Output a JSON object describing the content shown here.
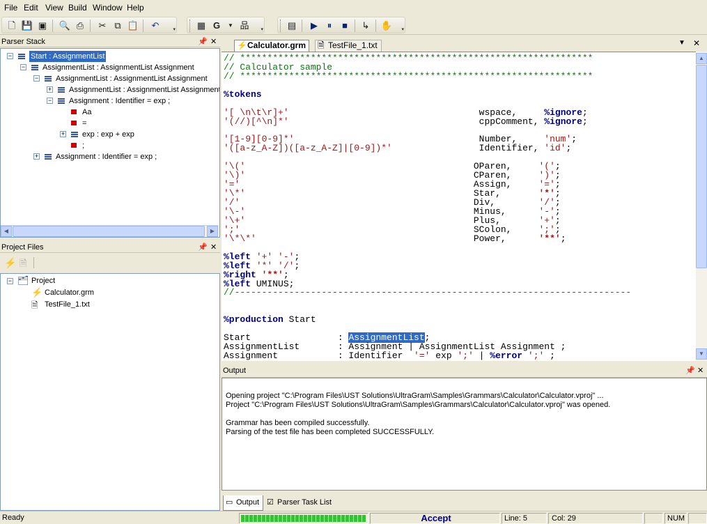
{
  "menu": [
    "File",
    "Edit",
    "View",
    "Build",
    "Window",
    "Help"
  ],
  "toolbar": {
    "icons": [
      "new-file-icon",
      "save-icon",
      "save-all-icon",
      "print-preview-icon",
      "print-icon",
      "cut-icon",
      "copy-icon",
      "paste-icon",
      "undo-icon",
      "grid-icon",
      "g-dropdown-icon",
      "tree-icon",
      "properties-icon",
      "run-icon",
      "pause-icon",
      "stop-icon",
      "step-icon",
      "hand-icon"
    ],
    "g_label": "G"
  },
  "parser_stack": {
    "title": "Parser Stack",
    "items": [
      {
        "label": "Start : AssignmentList",
        "level": 0,
        "icon": "list",
        "expander": "-",
        "selected": true
      },
      {
        "label": "AssignmentList : AssignmentList Assignment",
        "level": 1,
        "icon": "list",
        "expander": "-"
      },
      {
        "label": "AssignmentList : AssignmentList Assignment",
        "level": 2,
        "icon": "list",
        "expander": "-"
      },
      {
        "label": "AssignmentList : AssignmentList Assignment",
        "level": 3,
        "icon": "list",
        "expander": "+"
      },
      {
        "label": "Assignment : Identifier = exp ;",
        "level": 3,
        "icon": "list",
        "expander": "-"
      },
      {
        "label": "Aa",
        "level": 4,
        "icon": "term",
        "expander": ""
      },
      {
        "label": "=",
        "level": 4,
        "icon": "term",
        "expander": ""
      },
      {
        "label": "exp : exp + exp",
        "level": 4,
        "icon": "list",
        "expander": "+"
      },
      {
        "label": ";",
        "level": 4,
        "icon": "term",
        "expander": ""
      },
      {
        "label": "Assignment : Identifier = exp ;",
        "level": 2,
        "icon": "list",
        "expander": "+"
      }
    ]
  },
  "project_files": {
    "title": "Project Files",
    "root": "Project",
    "files": [
      "Calculator.grm",
      "TestFile_1.txt"
    ]
  },
  "editor": {
    "tabs": [
      {
        "label": "Calculator.grm",
        "active": true
      },
      {
        "label": "TestFile_1.txt",
        "active": false
      }
    ],
    "lines": [
      [
        [
          "g",
          "// *****************************************************************"
        ]
      ],
      [
        [
          "g",
          "// Calculator sample"
        ]
      ],
      [
        [
          "g",
          "// *****************************************************************"
        ]
      ],
      [],
      [
        [
          "kw",
          "%tokens"
        ]
      ],
      [],
      [
        [
          "s",
          "'[ \\n\\t\\r]+'"
        ],
        [
          "n",
          "                                   wspace,     "
        ],
        [
          "kw",
          "%ignore"
        ],
        [
          "n",
          ";"
        ]
      ],
      [
        [
          "s",
          "'(//)[^\\n]*'"
        ],
        [
          "n",
          "                                   cppComment, "
        ],
        [
          "kw",
          "%ignore"
        ],
        [
          "n",
          ";"
        ]
      ],
      [],
      [
        [
          "s",
          "'[1-9][0-9]*'"
        ],
        [
          "n",
          "                                  Number,     "
        ],
        [
          "s",
          "'num'"
        ],
        [
          "n",
          ";"
        ]
      ],
      [
        [
          "s",
          "'([a-z_A-Z])([a-z_A-Z]|[0-9])*'"
        ],
        [
          "n",
          "                Identifier, "
        ],
        [
          "s",
          "'id'"
        ],
        [
          "n",
          ";"
        ]
      ],
      [],
      [
        [
          "s",
          "'\\('"
        ],
        [
          "n",
          "                                          OParen,     "
        ],
        [
          "s",
          "'('"
        ],
        [
          "n",
          ";"
        ]
      ],
      [
        [
          "s",
          "'\\)'"
        ],
        [
          "n",
          "                                          CParen,     "
        ],
        [
          "s",
          "')'"
        ],
        [
          "n",
          ";"
        ]
      ],
      [
        [
          "s",
          "'='"
        ],
        [
          "n",
          "                                           Assign,     "
        ],
        [
          "s",
          "'='"
        ],
        [
          "n",
          ";"
        ]
      ],
      [
        [
          "s",
          "'\\*'"
        ],
        [
          "n",
          "                                          Star,       "
        ],
        [
          "sb",
          "'*'"
        ],
        [
          "n",
          ";"
        ]
      ],
      [
        [
          "s",
          "'/'"
        ],
        [
          "n",
          "                                           Div,        "
        ],
        [
          "s",
          "'/'"
        ],
        [
          "n",
          ";"
        ]
      ],
      [
        [
          "s",
          "'\\-'"
        ],
        [
          "n",
          "                                          Minus,      "
        ],
        [
          "s",
          "'-'"
        ],
        [
          "n",
          ";"
        ]
      ],
      [
        [
          "s",
          "'\\+'"
        ],
        [
          "n",
          "                                          Plus,       "
        ],
        [
          "s",
          "'+'"
        ],
        [
          "n",
          ";"
        ]
      ],
      [
        [
          "s",
          "';'"
        ],
        [
          "n",
          "                                           SColon,     "
        ],
        [
          "s",
          "';'"
        ],
        [
          "n",
          ";"
        ]
      ],
      [
        [
          "s",
          "'\\*\\*'"
        ],
        [
          "n",
          "                                        Power,      "
        ],
        [
          "sb",
          "'**'"
        ],
        [
          "n",
          ";"
        ]
      ],
      [],
      [
        [
          "kw",
          "%left"
        ],
        [
          "n",
          " "
        ],
        [
          "s",
          "'+'"
        ],
        [
          "n",
          " "
        ],
        [
          "s",
          "'-'"
        ],
        [
          "n",
          ";"
        ]
      ],
      [
        [
          "kw",
          "%left"
        ],
        [
          "n",
          " "
        ],
        [
          "s",
          "'*'"
        ],
        [
          "n",
          " "
        ],
        [
          "s",
          "'/'"
        ],
        [
          "n",
          ";"
        ]
      ],
      [
        [
          "kw",
          "%right"
        ],
        [
          "n",
          " "
        ],
        [
          "sb",
          "'**'"
        ],
        [
          "n",
          ";"
        ]
      ],
      [
        [
          "kw",
          "%left"
        ],
        [
          "n",
          " UMINUS;"
        ]
      ],
      [
        [
          "g",
          "//-------------------------------------------------------------------------"
        ]
      ],
      [],
      [],
      [
        [
          "kw",
          "%production"
        ],
        [
          "n",
          " Start"
        ]
      ],
      [],
      [
        [
          "n",
          "Start                "
        ],
        [
          "n",
          ": "
        ],
        [
          "hl",
          "AssignmentList"
        ],
        [
          "n",
          ";"
        ]
      ],
      [
        [
          "n",
          "AssignmentList       : Assignment | AssignmentList Assignment ;"
        ]
      ],
      [
        [
          "n",
          "Assignment           : Identifier  "
        ],
        [
          "s",
          "'='"
        ],
        [
          "n",
          " exp "
        ],
        [
          "s",
          "';'"
        ],
        [
          "n",
          " | "
        ],
        [
          "kw",
          "%error"
        ],
        [
          "n",
          " "
        ],
        [
          "s",
          "';'"
        ],
        [
          "n",
          " ;"
        ]
      ]
    ]
  },
  "output": {
    "title": "Output",
    "lines": [
      "Opening project \"C:\\Program Files\\UST Solutions\\UltraGram\\Samples\\Grammars\\Calculator\\Calculator.vproj\" ...",
      "Project \"C:\\Program Files\\UST Solutions\\UltraGram\\Samples\\Grammars\\Calculator\\Calculator.vproj\" was opened.",
      "",
      "Grammar has been compiled successfully.",
      "Parsing of the test file has been completed SUCCESSFULLY."
    ],
    "tabs": [
      "Output",
      "Parser Task List"
    ]
  },
  "status": {
    "ready": "Ready",
    "progress": 1.0,
    "accept": "Accept",
    "line": "Line: 5",
    "col": "Col: 29",
    "num": "NUM"
  }
}
